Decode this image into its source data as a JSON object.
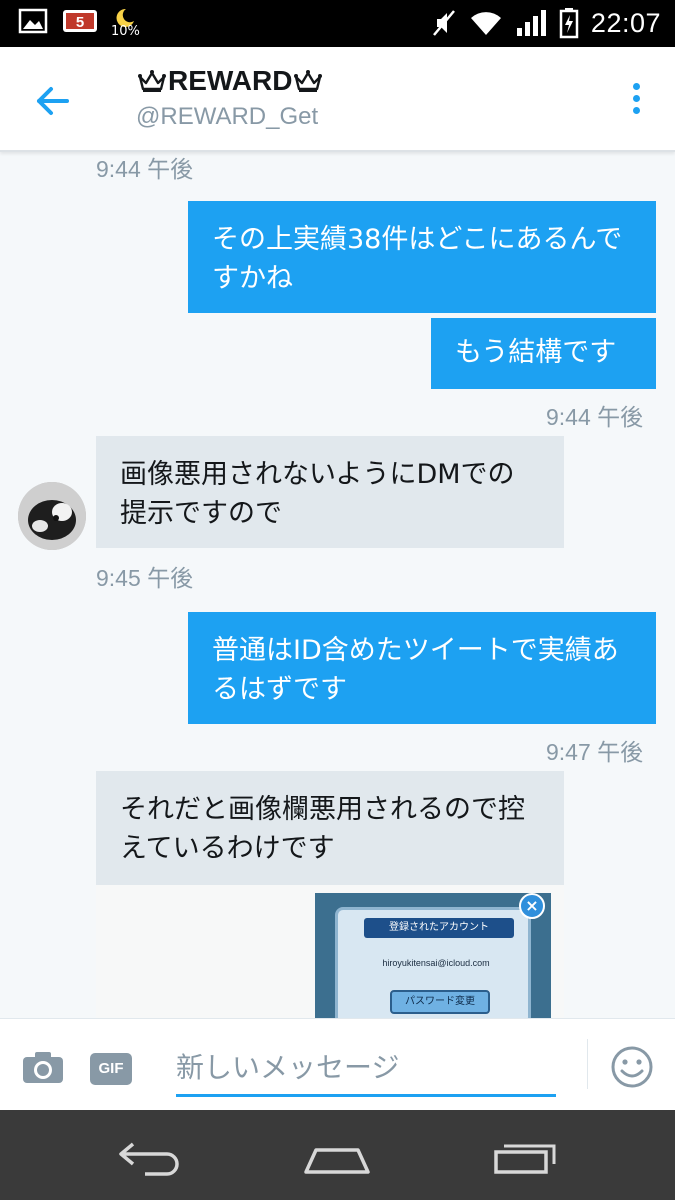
{
  "status_bar": {
    "battery_percent": "10%",
    "time": "22:07"
  },
  "header": {
    "title": "REWARD",
    "handle": "@REWARD_Get"
  },
  "messages": {
    "ts_top": "9:44 午後",
    "m1": "その上実績38件はどこにあるんですかね",
    "m2": "もう結構です",
    "ts_m2": "9:44 午後",
    "m3": "画像悪用されないようにDMでの提示ですので",
    "ts_m3": "9:45 午後",
    "m4": "普通はID含めたツイートで実績あるはずです",
    "ts_m4": "9:47 午後",
    "m5": "それだと画像欄悪用されるので控えているわけです",
    "attachment": {
      "dialog_title": "登録されたアカウント",
      "email": "hiroyukitensai@icloud.com",
      "button": "パスワード変更"
    }
  },
  "composer": {
    "gif_label": "GIF",
    "placeholder": "新しいメッセージ"
  },
  "colors": {
    "accent": "#1da1f2",
    "incoming_bubble": "#e1e8ed",
    "timestamp": "#8899a6"
  }
}
